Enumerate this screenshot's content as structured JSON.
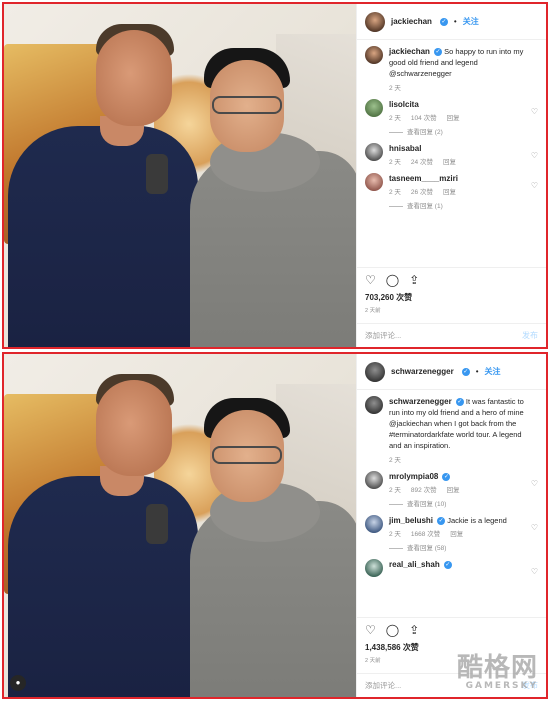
{
  "top_post": {
    "header": {
      "username": "jackiechan",
      "separator": "•",
      "follow": "关注"
    },
    "caption": {
      "username": "jackiechan",
      "text": "So happy to run into my good old friend and legend",
      "mention": "@schwarzenegger",
      "time": "2 天"
    },
    "comments": [
      {
        "user": "lisolcita",
        "text": "",
        "time": "2 天",
        "likes": "104 次赞",
        "reply": "回复",
        "view_replies": "查看回复 (2)"
      },
      {
        "user": "hnisabal",
        "text": "",
        "time": "2 天",
        "likes": "24 次赞",
        "reply": "回复",
        "view_replies": ""
      },
      {
        "user": "tasneem____mziri",
        "text": "",
        "time": "2 天",
        "likes": "26 次赞",
        "reply": "回复",
        "view_replies": "查看回复 (1)"
      }
    ],
    "likes": "703,260 次赞",
    "when": "2 天前",
    "add_comment_placeholder": "添加评论...",
    "post_button": "发布"
  },
  "bottom_post": {
    "header": {
      "username": "schwarzenegger",
      "separator": "•",
      "follow": "关注"
    },
    "caption": {
      "username": "schwarzenegger",
      "text_before": "It was fantastic to run into my old friend and a hero of mine",
      "mention": "@jackiechan",
      "text_mid": "when I got back from the",
      "hashtag": "#terminatordarkfate",
      "text_after": "world tour. A legend and an inspiration.",
      "time": "2 天"
    },
    "comments": [
      {
        "user": "mrolympia08",
        "text": "",
        "time": "2 天",
        "likes": "892 次赞",
        "reply": "回复",
        "view_replies": "查看回复 (10)"
      },
      {
        "user": "jim_belushi",
        "text": "Jackie is a legend",
        "time": "2 天",
        "likes": "1668 次赞",
        "reply": "回复",
        "view_replies": "查看回复 (58)"
      },
      {
        "user": "real_ali_shah",
        "text": "",
        "time": "",
        "likes": "",
        "reply": "",
        "view_replies": ""
      }
    ],
    "likes": "1,438,586 次赞",
    "when": "2 天前",
    "add_comment_placeholder": "添加评论...",
    "post_button": "发布"
  },
  "icons": {
    "heart": "heart-icon",
    "comment": "comment-icon",
    "share": "share-icon",
    "verified": "verified-badge-icon"
  },
  "colors": {
    "frame": "#e0252b",
    "link": "#3897f0",
    "verified": "#3897f0"
  },
  "watermark": {
    "main": "酷格网",
    "sub": "GAMERSKY"
  }
}
